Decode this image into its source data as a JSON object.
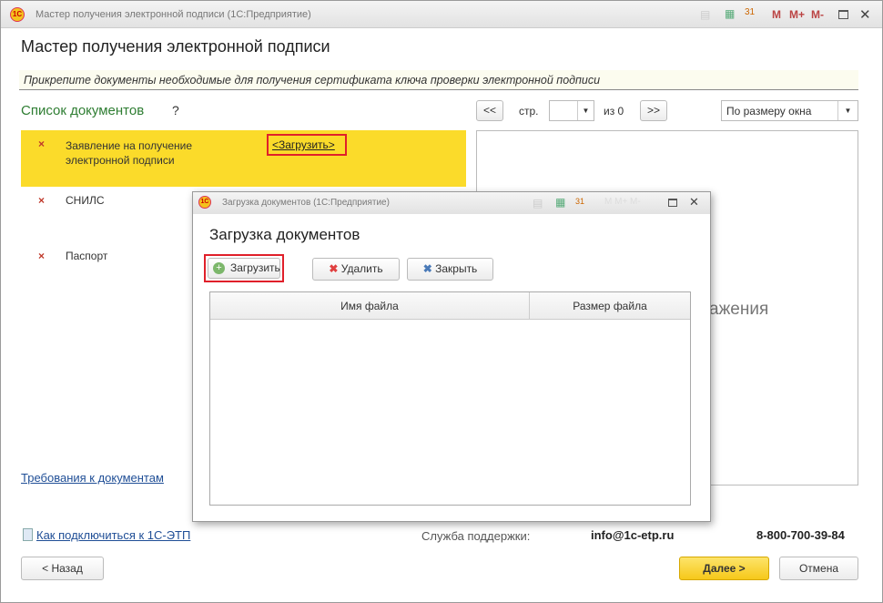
{
  "window": {
    "title": "Мастер получения электронной подписи  (1С:Предприятие)",
    "logo": "1С",
    "heading": "Мастер получения электронной подписи",
    "instruction": "Прикрепите документы  необходимые для получения сертификата ключа проверки электронной подписи",
    "toolbar_icons": [
      "document-icon",
      "calculator-icon",
      "calendar-icon",
      "M",
      "M+",
      "M-",
      "maximize-icon",
      "close-icon"
    ]
  },
  "docs": {
    "title": "Список документов",
    "help": "?",
    "items": [
      {
        "name": "Заявление на получение электронной подписи",
        "mark": "×",
        "action": "<Загрузить>",
        "selected": true
      },
      {
        "name": "СНИЛС",
        "mark": "×"
      },
      {
        "name": "Паспорт",
        "mark": "×"
      }
    ],
    "requirements_link": "Требования к документам"
  },
  "pager": {
    "prev": "<<",
    "page_label": "стр.",
    "page_value": "",
    "of": "из 0",
    "next": ">>",
    "zoom": "По размеру окна"
  },
  "preview": {
    "placeholder": "ажения"
  },
  "dialog": {
    "title": "Загрузка документов  (1С:Предприятие)",
    "heading": "Загрузка документов",
    "buttons": {
      "upload": "Загрузить",
      "delete": "Удалить",
      "close": "Закрыть"
    },
    "columns": [
      "Имя файла",
      "Размер файла"
    ],
    "rows": []
  },
  "footer": {
    "howto_link": "Как подключиться к 1С-ЭТП",
    "support_label": "Служба поддержки:",
    "email": "info@1c-etp.ru",
    "phone": "8-800-700-39-84",
    "back": "< Назад",
    "next": "Далее >",
    "cancel": "Отмена"
  },
  "colors": {
    "selected_row": "#fbdb2a",
    "accent_green": "#2e7d32",
    "highlight": "#e0202a",
    "next_button": "#f6c81a"
  }
}
